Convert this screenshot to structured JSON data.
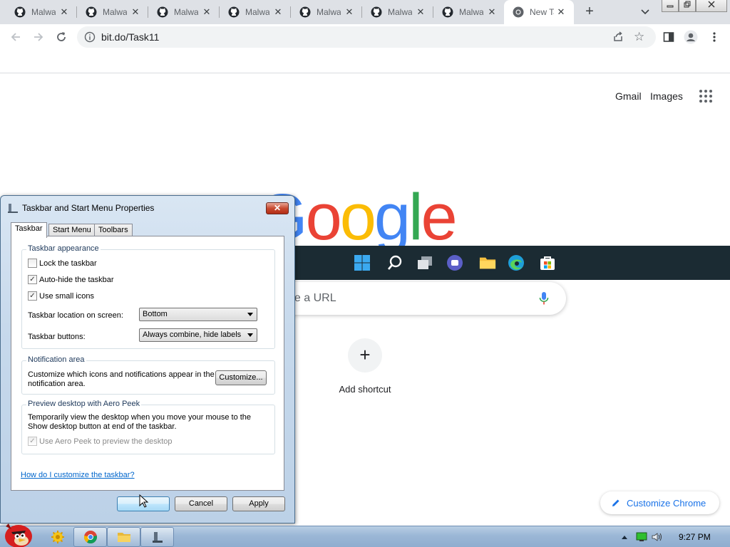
{
  "browser": {
    "tabs": [
      {
        "title": "Malware",
        "icon": "github-icon"
      },
      {
        "title": "Malware",
        "icon": "github-icon"
      },
      {
        "title": "Malware",
        "icon": "github-icon"
      },
      {
        "title": "Malware",
        "icon": "github-icon"
      },
      {
        "title": "Malware",
        "icon": "github-icon"
      },
      {
        "title": "Malware",
        "icon": "github-icon"
      },
      {
        "title": "Malware",
        "icon": "github-icon"
      },
      {
        "title": "New Tab",
        "icon": "chrome-icon",
        "active": true
      }
    ],
    "url": "bit.do/Task11"
  },
  "ntp": {
    "links": {
      "gmail": "Gmail",
      "images": "Images"
    },
    "logo": "Google",
    "search_placeholder": "ype a URL",
    "shortcut_label": "Add shortcut",
    "customize_label": "Customize Chrome"
  },
  "dialog": {
    "title": "Taskbar and Start Menu Properties",
    "tabs": [
      "Taskbar",
      "Start Menu",
      "Toolbars"
    ],
    "appearance": {
      "title": "Taskbar appearance",
      "lock": {
        "label": "Lock the taskbar",
        "checked": false
      },
      "autohide": {
        "label": "Auto-hide the taskbar",
        "checked": true
      },
      "small_icons": {
        "label": "Use small icons",
        "checked": true
      },
      "location_label": "Taskbar location on screen:",
      "location_value": "Bottom",
      "buttons_label": "Taskbar buttons:",
      "buttons_value": "Always combine, hide labels"
    },
    "notification": {
      "title": "Notification area",
      "text": "Customize which icons and notifications appear in the notification area.",
      "customize_button": "Customize..."
    },
    "aero_peek": {
      "title": "Preview desktop with Aero Peek",
      "text": "Temporarily view the desktop when you move your mouse to the Show desktop button at end of the taskbar.",
      "use_label": "Use Aero Peek to preview the desktop",
      "checked": true,
      "disabled": true
    },
    "help_link": "How do I customize the taskbar?",
    "buttons": {
      "ok": "",
      "cancel": "Cancel",
      "apply": "Apply"
    }
  },
  "taskbar": {
    "time": "9:27 PM"
  },
  "colors": {
    "google_blue": "#4285f4",
    "google_red": "#ea4335",
    "google_yellow": "#fbbc05",
    "google_green": "#34a853",
    "chrome_blue": "#1a73e8",
    "w11_bar": "#1b2b33"
  }
}
